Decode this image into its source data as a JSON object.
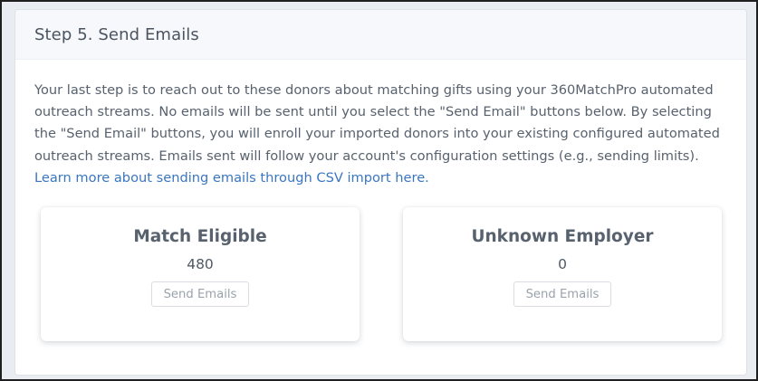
{
  "panel": {
    "title": "Step 5. Send Emails"
  },
  "intro": {
    "text": "Your last step is to reach out to these donors about matching gifts using your 360MatchPro automated outreach streams. No emails will be sent until you select the \"Send Email\" buttons below. By selecting the \"Send Email\" buttons, you will enroll your imported donors into your existing configured automated outreach streams. Emails sent will follow your account's configuration settings (e.g., sending limits). ",
    "link_text": "Learn more about sending emails through CSV import here."
  },
  "cards": [
    {
      "title": "Match Eligible",
      "count": "480",
      "button_label": "Send Emails"
    },
    {
      "title": "Unknown Employer",
      "count": "0",
      "button_label": "Send Emails"
    }
  ],
  "colors": {
    "link": "#3a76c0",
    "text": "#58626e",
    "header_bg": "#f7f8fb"
  }
}
